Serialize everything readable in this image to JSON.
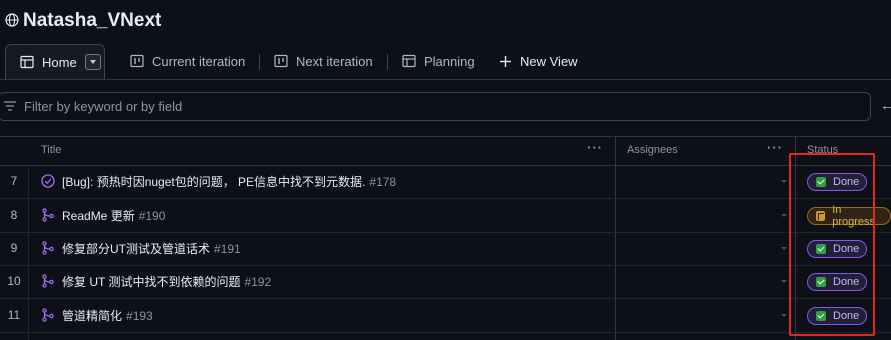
{
  "project": {
    "title": "Natasha_VNext",
    "icon": "globe-icon"
  },
  "tabs": [
    {
      "label": "Home",
      "icon": "table-icon",
      "active": true
    },
    {
      "label": "Current iteration",
      "icon": "board-icon"
    },
    {
      "label": "Next iteration",
      "icon": "board-icon"
    },
    {
      "label": "Planning",
      "icon": "table-icon"
    }
  ],
  "new_view": {
    "label": "New View",
    "icon": "plus-icon"
  },
  "filter": {
    "placeholder": "Filter by keyword or by field",
    "icon": "filter-icon"
  },
  "table": {
    "columns": [
      "Title",
      "Assignees",
      "Status"
    ],
    "more_label": "···",
    "rows": [
      {
        "num": "7",
        "icon": "issue-closed-icon",
        "title": "[Bug]: 预热时因nuget包的问题， PE信息中找不到元数据.",
        "ref": "#178",
        "status": "Done"
      },
      {
        "num": "8",
        "icon": "pull-request-merged-icon",
        "title": "ReadMe 更新",
        "ref": "#190",
        "status": "In progress"
      },
      {
        "num": "9",
        "icon": "pull-request-merged-icon",
        "title": "修复部分UT测试及管道话术",
        "ref": "#191",
        "status": "Done"
      },
      {
        "num": "10",
        "icon": "pull-request-merged-icon",
        "title": "修复 UT 测试中找不到依赖的问题",
        "ref": "#192",
        "status": "Done"
      },
      {
        "num": "11",
        "icon": "pull-request-merged-icon",
        "title": "管道精简化",
        "ref": "#193",
        "status": "Done"
      }
    ]
  },
  "colors": {
    "done": "#8957e5",
    "in_progress": "#d29922",
    "highlight": "#e5281f",
    "accent_icon": "#a371f7"
  }
}
